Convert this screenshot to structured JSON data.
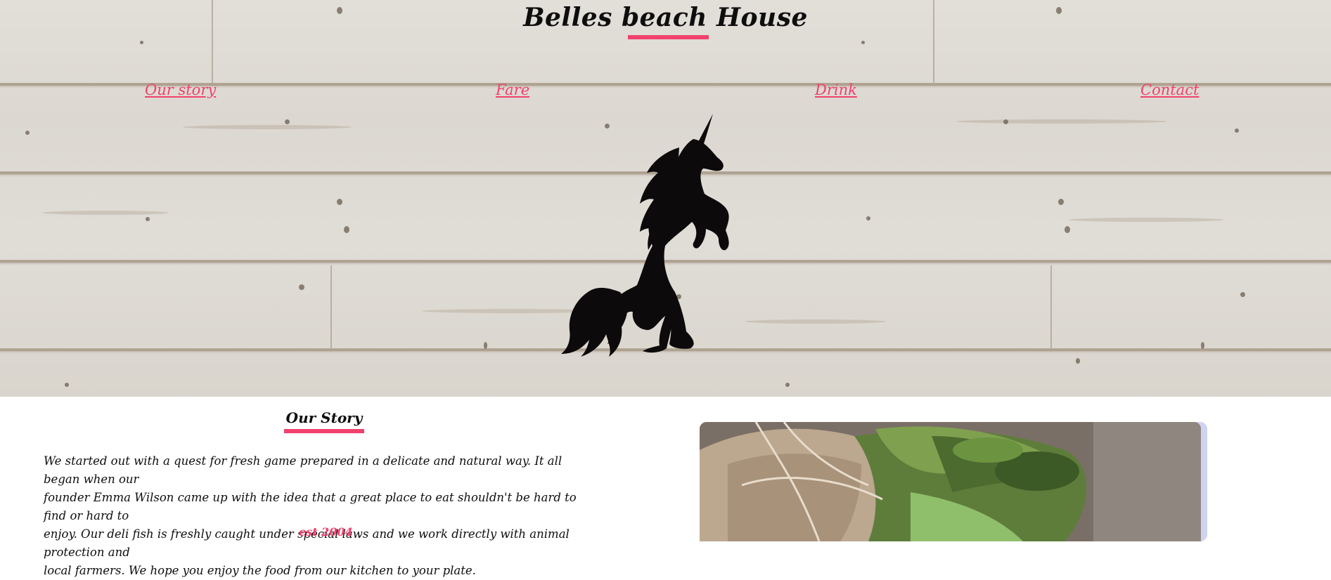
{
  "header": {
    "title": "Belles beach House"
  },
  "nav": {
    "items": [
      {
        "label": "Our story"
      },
      {
        "label": "Fare"
      },
      {
        "label": "Drink"
      },
      {
        "label": "Contact"
      }
    ]
  },
  "hero": {
    "logo_icon": "unicorn-icon"
  },
  "story": {
    "heading": "Our Story",
    "line1": "We started out with a quest for fresh game prepared in a delicate and natural way. It all began when our",
    "line2": "founder Emma Wilson came up with the idea that a great place to eat shouldn't be hard to find or hard to",
    "line3": "enjoy. Our deli fish is freshly caught under special laws and we work directly with animal protection and",
    "line4": "local farmers. We hope you enjoy the food from our kitchen to your plate.",
    "established": "est 2004"
  },
  "colors": {
    "accent": "#f1416d",
    "text": "#0e0e0e"
  }
}
